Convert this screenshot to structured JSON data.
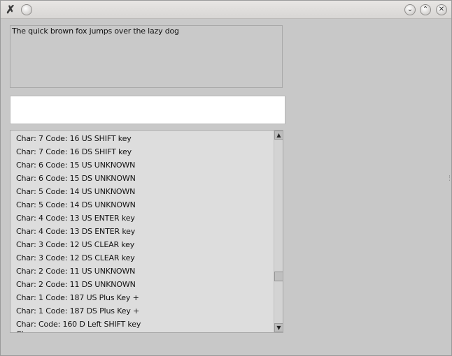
{
  "window": {
    "titlebar_icons": {
      "app": "x-app-icon",
      "sticky": "circle-icon",
      "minimize": "chevron-down-icon",
      "maximize": "chevron-up-icon",
      "close": "close-icon"
    }
  },
  "text_display": {
    "value": "The quick brown fox jumps over the lazy dog"
  },
  "input": {
    "value": "",
    "placeholder": ""
  },
  "event_list": {
    "items": [
      "Char: 7 Code: 16 US  SHIFT key",
      "Char: 7 Code: 16 DS  SHIFT key",
      "Char: 6 Code: 15 US  UNKNOWN",
      "Char: 6 Code: 15 DS  UNKNOWN",
      "Char: 5 Code: 14 US  UNKNOWN",
      "Char: 5 Code: 14 DS  UNKNOWN",
      "Char: 4 Code: 13 US  ENTER key",
      "Char: 4 Code: 13 DS  ENTER key",
      "Char: 3 Code: 12 US  CLEAR key",
      "Char: 3 Code: 12 DS  CLEAR key",
      "Char: 2 Code: 11 US  UNKNOWN",
      "Char: 2 Code: 11 DS  UNKNOWN",
      "Char: 1 Code: 187 US  Plus Key +",
      "Char: 1 Code: 187 DS  Plus Key +",
      "Char:  Code: 160 D   Left SHIFT key",
      "Char:"
    ],
    "scroll_position": 0.72
  }
}
